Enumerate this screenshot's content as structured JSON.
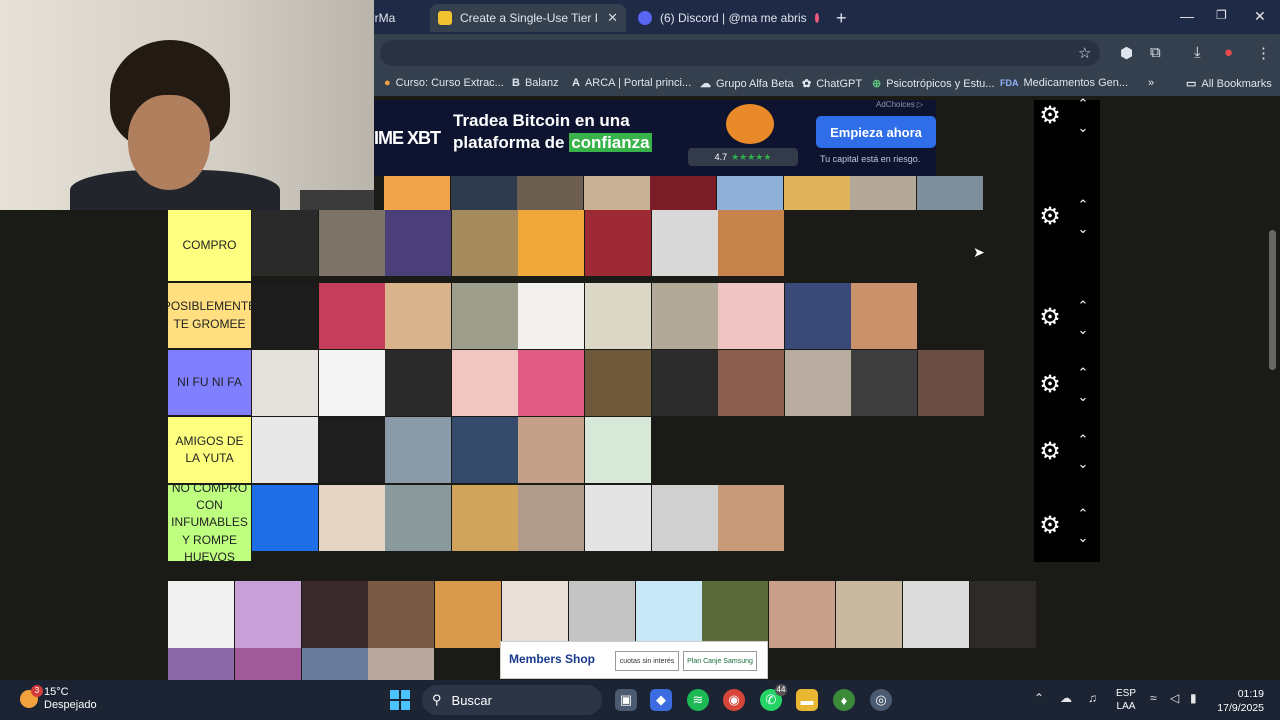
{
  "tabs": [
    {
      "label": "erMa",
      "active": false,
      "color": "#e65a2c"
    },
    {
      "label": "Create a Single-Use Tier List (Pr",
      "active": true,
      "color": "#f2c230"
    },
    {
      "label": "(6) Discord | @ma me abris",
      "active": false,
      "color": "#5865f2"
    }
  ],
  "new_tab_label": "+",
  "bookmarks": [
    {
      "icon": "●",
      "label": "Curso: Curso Extrac...",
      "color": "#f2a23c"
    },
    {
      "icon": "B",
      "label": "Balanz",
      "color": "#ffffff"
    },
    {
      "icon": "A",
      "label": "ARCA | Portal princi...",
      "color": "#ffffff"
    },
    {
      "icon": "☁",
      "label": "Grupo Alfa Beta",
      "color": "#cfd6e2"
    },
    {
      "icon": "✿",
      "label": "ChatGPT",
      "color": "#ffffff"
    },
    {
      "icon": "⊕",
      "label": "Psicotrópicos y Estu...",
      "color": "#5fc07a"
    },
    {
      "icon": "FDA",
      "label": "Medicamentos Gen...",
      "color": "#8fb4ff"
    }
  ],
  "bookmarks_more": "»",
  "all_bookmarks": "All Bookmarks",
  "ad": {
    "brand": "IME XBT",
    "line1": "Tradea Bitcoin en una",
    "line2_pre": "plataforma de ",
    "line2_highlight": "confianza",
    "rating": "4.7",
    "stars": "★★★★★",
    "button": "Empieza ahora",
    "disclaimer": "Tu capital está en riesgo.",
    "adchoices": "AdChoices ▷"
  },
  "tiers": [
    {
      "label": "",
      "color": "#1a1a17",
      "tiles": [
        "#f0a34a",
        "#2d3b4c",
        "#6d5e52",
        "#c9b196",
        "#7a1d26",
        "#8fb0d8",
        "#e0b45a",
        "#b4a89a",
        "#7e8f9c"
      ]
    },
    {
      "label": "COMPRO",
      "color": "#ffff7f",
      "tiles": [
        "#2a2a2a",
        "#7d7369",
        "#4b3f7a",
        "#a58a5e",
        "#f0a83a",
        "#9e2a36",
        "#d8d8d8",
        "#c7834c"
      ]
    },
    {
      "label": "POSIBLEMENTE TE GROMEE",
      "color": "#ffdf7f",
      "tiles": [
        "#1c1c1c",
        "#c43d5a",
        "#d9b48c",
        "#9e9e8c",
        "#f3f0f0",
        "#dcd8c8",
        "#b2a897",
        "#f1c4c4",
        "#3a4a78",
        "#c9926a"
      ]
    },
    {
      "label": "NI FU NI FA",
      "color": "#7f7fff",
      "tiles": [
        "#e4e0dc",
        "#f4f4f4",
        "#2a2a2a",
        "#f2c6c0",
        "#e05a84",
        "#6e5a3a",
        "#2c2c2c",
        "#8a5e4e",
        "#b8aca0",
        "#3e3e3e",
        "#6a4e44"
      ]
    },
    {
      "label": "AMIGOS DE LA YUTA",
      "color": "#ffff7f",
      "tiles": [
        "#e8e8e8",
        "#1e1e1e",
        "#8a9aa8",
        "#344a6a",
        "#c4a08a",
        "#d8e8d8"
      ]
    },
    {
      "label": "NO COMPRO CON INFUMABLES Y ROMPE HUEVOS",
      "color": "#bfff7f",
      "tiles": [
        "#1e6ee8",
        "#e6d4c4",
        "#8a9a9c",
        "#d0a45a",
        "#b09a8a",
        "#e4e4e4",
        "#d0d0d0",
        "#c89a7a"
      ]
    }
  ],
  "pool_tiles": [
    "#f0f0f0",
    "#c8a0d8",
    "#3a2a2e",
    "#7a5a44",
    "#d89a4a",
    "#e8e0d8",
    "#c4c4c4",
    "#c8e8f8",
    "#5a6a3a",
    "#c8a08a",
    "#c8b8a0",
    "#dcdcdc",
    "#2e2a2a",
    "#8a6aa8",
    "#a05a9a",
    "#6a7a9a",
    "#b8a8a0"
  ],
  "bottom_ad": {
    "title": "Members Shop",
    "promo1": "cuotas sin interés",
    "promo2": "Plan Canje Samsung"
  },
  "taskbar": {
    "temp": "15°C",
    "weather": "Despejado",
    "weather_badge": "3",
    "search": "Buscar",
    "whatsapp_badge": "44",
    "lang1": "ESP",
    "lang2": "LAA",
    "time": "01:19",
    "date": "17/9/2025"
  }
}
